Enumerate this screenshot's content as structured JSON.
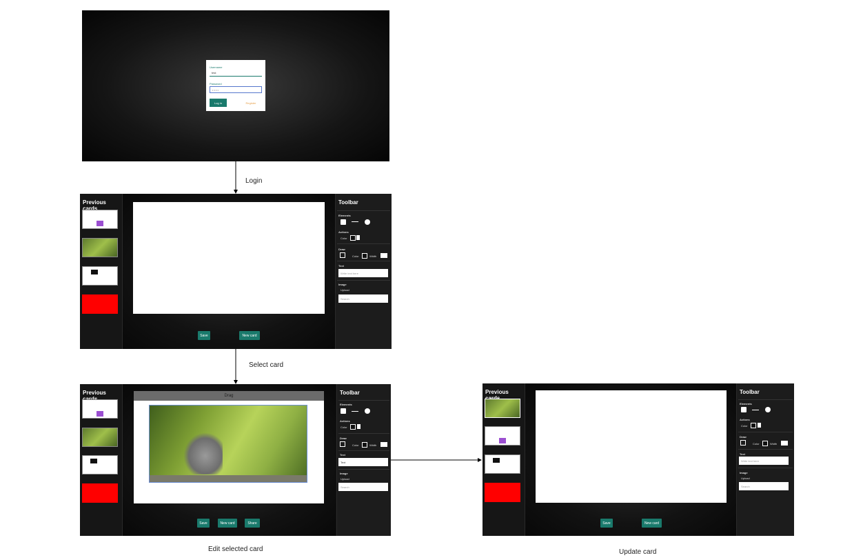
{
  "steps": {
    "login": "Login",
    "select": "Select card",
    "edit": "Edit selected card",
    "update": "Update card"
  },
  "login_form": {
    "username_label": "Username",
    "username_value": "test",
    "password_label": "Password",
    "password_value": "• • • •",
    "login_button": "Log in",
    "register_button": "Register"
  },
  "app": {
    "sidebar_title": "Previous cards",
    "toolbar_title": "Toolbar",
    "elements_label": "Elements",
    "actions_label": "Actions",
    "color_label": "Color",
    "draw_label": "Draw",
    "width_label": "Width",
    "text_label": "Text",
    "text_placeholder": "Write text here",
    "text_value": "Text",
    "image_label": "Image",
    "upload_label": "Upload",
    "search_placeholder": "Search",
    "save_button": "Save",
    "new_card_button": "New card",
    "share_button": "Share",
    "drag_handle": "Drag"
  },
  "colors": {
    "accent": "#1a7a6c",
    "red_card": "#ff0000",
    "purple_shape": "#9b4fd1"
  }
}
